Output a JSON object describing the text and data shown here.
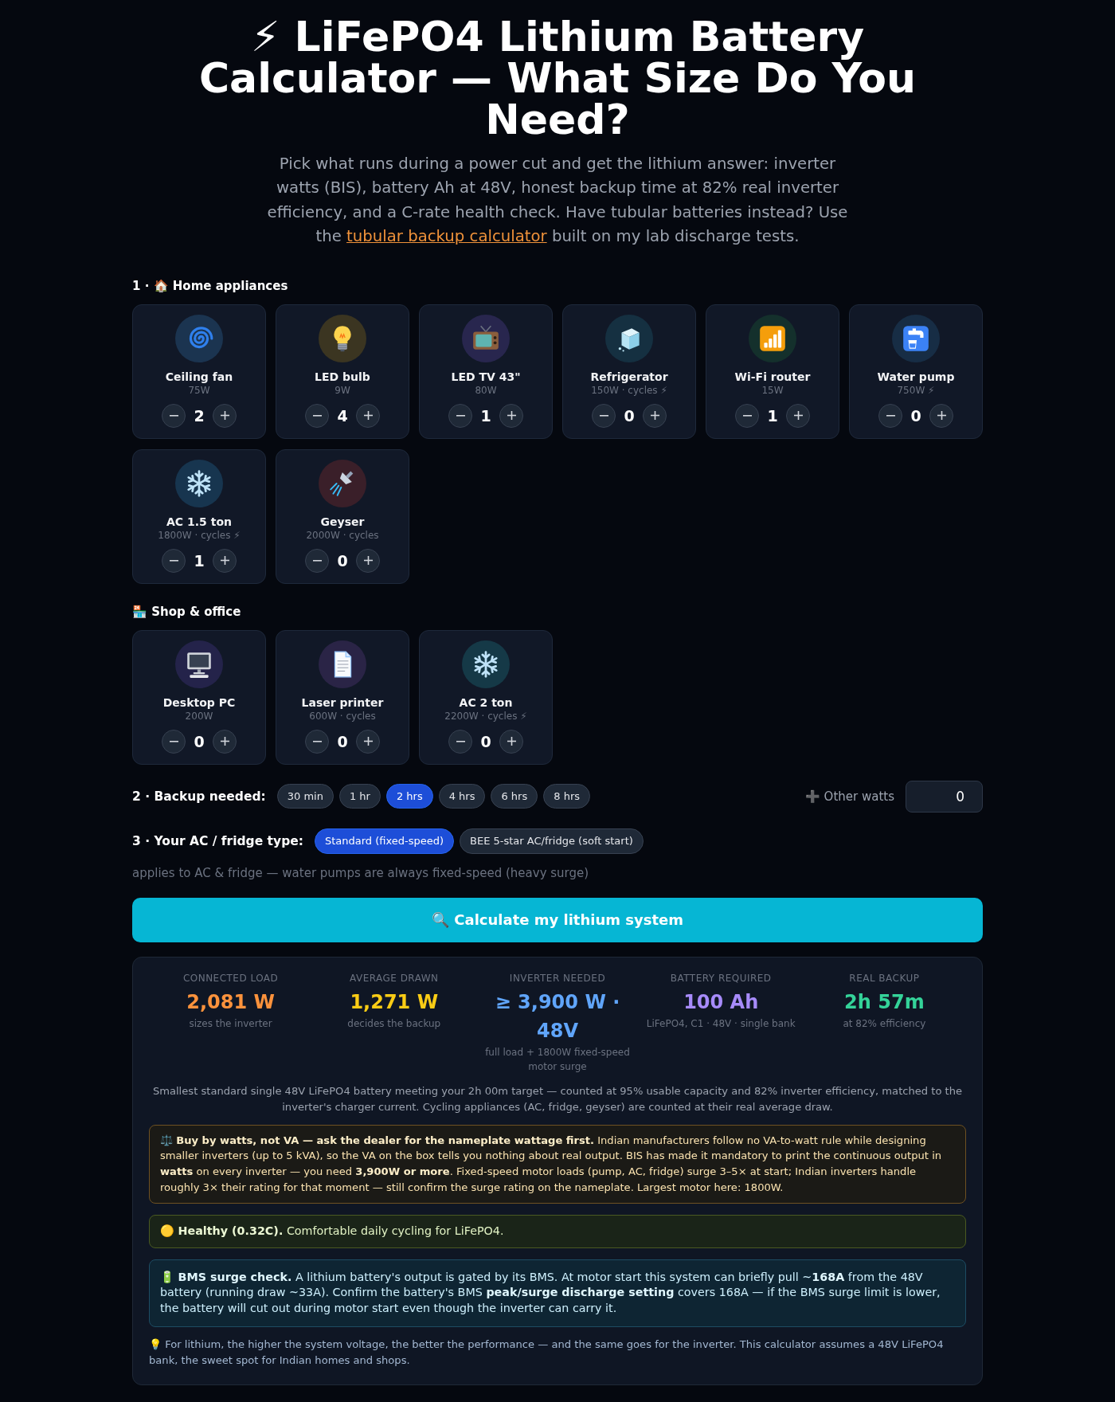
{
  "title": "⚡ LiFePO4 Lithium Battery Calculator — What Size Do You Need?",
  "intro": {
    "text_before": "Pick what runs during a power cut and get the lithium answer: inverter watts (BIS), battery Ah at 48V, honest backup time at 82% real inverter efficiency, and a C-rate health check. Have tubular batteries instead? Use the",
    "link": "tubular backup calculator",
    "text_after": "built on my lab discharge tests."
  },
  "sections": [
    {
      "heading": "1 · 🏠 Home appliances",
      "appliances": [
        {
          "name": "Ceiling fan",
          "watts": "75W",
          "count": "2",
          "kind": "spiral",
          "color": "#1b3450"
        },
        {
          "name": "LED bulb",
          "watts": "9W",
          "count": "4",
          "kind": "bulb",
          "color": "#3b3521"
        },
        {
          "name": "LED TV 43\"",
          "watts": "80W",
          "count": "1",
          "kind": "tv",
          "color": "#28264e"
        },
        {
          "name": "Refrigerator",
          "watts": "150W · cycles ⚡",
          "count": "0",
          "kind": "ice",
          "color": "#153041"
        },
        {
          "name": "Wi-Fi router",
          "watts": "15W",
          "count": "1",
          "kind": "signal",
          "color": "#14302c"
        },
        {
          "name": "Water pump",
          "watts": "750W ⚡",
          "count": "0",
          "kind": "faucet",
          "color": "#172d45"
        },
        {
          "name": "AC 1.5 ton",
          "watts": "1800W · cycles ⚡",
          "count": "1",
          "kind": "snowflake",
          "color": "#17354f"
        },
        {
          "name": "Geyser",
          "watts": "2000W · cycles",
          "count": "0",
          "kind": "shower",
          "color": "#3a1f29"
        }
      ]
    },
    {
      "heading": "🏪 Shop & office",
      "appliances": [
        {
          "name": "Desktop PC",
          "watts": "200W",
          "count": "0",
          "kind": "computer",
          "color": "#24234a"
        },
        {
          "name": "Laser printer",
          "watts": "600W · cycles",
          "count": "0",
          "kind": "document",
          "color": "#2a2446"
        },
        {
          "name": "AC 2 ton",
          "watts": "2200W · cycles ⚡",
          "count": "0",
          "kind": "snowflake",
          "color": "#153947"
        }
      ]
    }
  ],
  "backup": {
    "label": "2 · Backup needed:",
    "options": [
      {
        "label": "30 min",
        "selected": false
      },
      {
        "label": "1 hr",
        "selected": false
      },
      {
        "label": "2 hrs",
        "selected": true
      },
      {
        "label": "4 hrs",
        "selected": false
      },
      {
        "label": "6 hrs",
        "selected": false
      },
      {
        "label": "8 hrs",
        "selected": false
      }
    ],
    "other_watts": {
      "label": "➕ Other watts",
      "value": "0"
    }
  },
  "load_type": {
    "label": "3 · Your AC / fridge type:",
    "options": [
      {
        "label": "Standard (fixed-speed)",
        "selected": true
      },
      {
        "label": "BEE 5-star AC/fridge (soft start)",
        "selected": false
      }
    ],
    "note": "applies to AC & fridge — water pumps are always fixed-speed (heavy surge)"
  },
  "calculate_button": "🔍 Calculate my lithium system",
  "results": {
    "stats": [
      {
        "label": "CONNECTED LOAD",
        "value": "2,081 W",
        "note": "sizes the inverter",
        "color": "#fb923c"
      },
      {
        "label": "AVERAGE DRAWN",
        "value": "1,271 W",
        "note": "decides the backup",
        "color": "#facc15"
      },
      {
        "label": "INVERTER NEEDED",
        "value": "≥ 3,900 W · 48V",
        "note": "full load + 1800W fixed-speed motor surge",
        "color": "#60a5fa"
      },
      {
        "label": "BATTERY REQUIRED",
        "value": "100 Ah",
        "note": "LiFePO4, C1 · 48V · single bank",
        "color": "#a78bfa"
      },
      {
        "label": "REAL BACKUP",
        "value": "2h 57m",
        "note": "at 82% efficiency",
        "color": "#34d399"
      }
    ],
    "summary": "Smallest standard single 48V LiFePO4 battery meeting your 2h 00m target — counted at 95% usable capacity and 82% inverter efficiency, matched to the inverter's charger current. Cycling appliances (AC, fridge, geyser) are counted at their real average draw.",
    "notes": [
      {
        "kind": "warning",
        "text": "⚖️ **Buy by watts, not VA — ask the dealer for the nameplate wattage first.** Indian manufacturers follow no VA-to-watt rule while designing smaller inverters (up to 5 kVA), so the VA on the box tells you nothing about real output. BIS has made it mandatory to print the continuous output in **watts** on every inverter — you need **3,900W or more**. Fixed-speed motor loads (pump, AC, fridge) surge 3–5× at start; Indian inverters handle roughly 3× their rating for that moment — still confirm the surge rating on the nameplate. Largest motor here: 1800W."
      },
      {
        "kind": "health",
        "text": "🟡 **Healthy (0.32C).** Comfortable daily cycling for LiFePO4."
      },
      {
        "kind": "info",
        "text": "🔋 **BMS surge check.** A lithium battery's output is gated by its BMS. At motor start this system can briefly pull ~**168A** from the 48V battery (running draw ~33A). Confirm the battery's BMS **peak/surge discharge setting** covers 168A — if the BMS surge limit is lower, the battery will cut out during motor start even though the inverter can carry it."
      },
      {
        "kind": "tip",
        "text": "💡 For lithium, the higher the system voltage, the better the performance — and the same goes for the inverter. This calculator assumes a 48V LiFePO4 bank, the sweet spot for Indian homes and shops."
      }
    ]
  }
}
